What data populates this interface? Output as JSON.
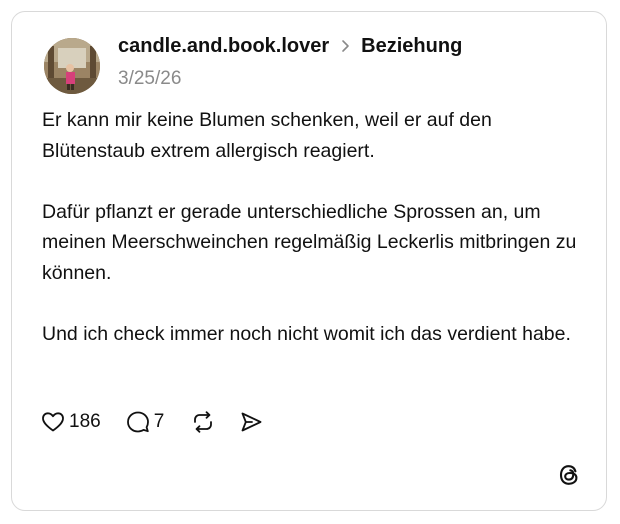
{
  "post": {
    "username": "candle.and.book.lover",
    "topic": "Beziehung",
    "date": "3/25/26",
    "paragraphs": [
      "Er kann mir keine Blumen schenken, weil er auf den Blütenstaub extrem allergisch reagiert.",
      "Dafür pflanzt er gerade unterschiedliche Sprossen an, um meinen Meerschweinchen regelmäßig Leckerlis mitbringen zu können.",
      "Und ich check immer noch nicht womit ich das verdient habe."
    ]
  },
  "actions": {
    "like_count": "186",
    "reply_count": "7"
  },
  "icons": {
    "like": "heart-icon",
    "reply": "speech-bubble-icon",
    "repost": "repost-icon",
    "share": "send-icon",
    "brand": "threads-logo-icon",
    "separator": "chevron-right-icon"
  },
  "colors": {
    "text": "#111111",
    "muted": "#8a8a8a",
    "border": "#d9d9d9"
  }
}
